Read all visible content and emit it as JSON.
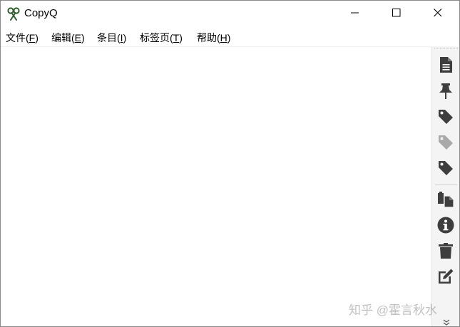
{
  "window": {
    "title": "CopyQ",
    "app_icon": "copyq-scissors-icon"
  },
  "controls": {
    "minimize_icon": "minimize-icon",
    "maximize_icon": "maximize-icon",
    "close_icon": "close-icon"
  },
  "menu": {
    "items": [
      {
        "label": "文件(",
        "mnemonic": "F",
        "suffix": ")"
      },
      {
        "label": "编辑(",
        "mnemonic": "E",
        "suffix": ")"
      },
      {
        "label": "条目(",
        "mnemonic": "I",
        "suffix": ")"
      },
      {
        "label": "标签页(",
        "mnemonic": "T",
        "suffix": ")"
      },
      {
        "label": "帮助(",
        "mnemonic": "H",
        "suffix": ")"
      }
    ]
  },
  "toolbar": {
    "buttons": [
      {
        "icon": "new-item-document-icon"
      },
      {
        "icon": "pin-icon"
      },
      {
        "icon": "tag-icon"
      },
      {
        "icon": "tag-disabled-icon"
      },
      {
        "icon": "tag-icon"
      },
      {
        "icon": "copy-icon"
      },
      {
        "icon": "info-icon"
      },
      {
        "icon": "trash-icon"
      },
      {
        "icon": "edit-icon"
      }
    ],
    "overflow_icon": "more-chevron-icon"
  },
  "watermark": {
    "text": "知乎 @霍言秋水"
  },
  "colors": {
    "icon": "#3e3e3e",
    "icon_disabled": "#a9a9a9",
    "toolbar_bg": "#f4f4f4"
  }
}
